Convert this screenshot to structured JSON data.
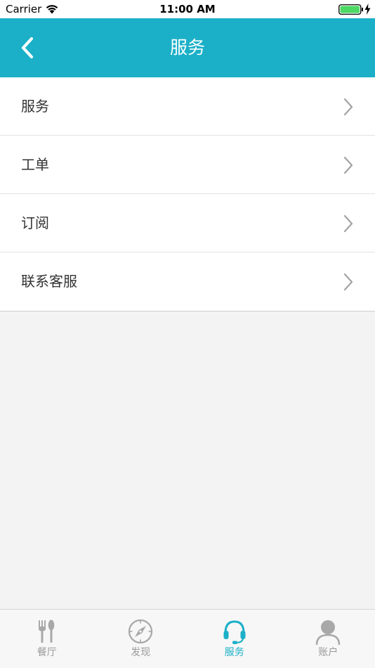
{
  "status_bar": {
    "carrier": "Carrier",
    "time": "11:00 AM"
  },
  "nav": {
    "title": "服务",
    "back_icon": "chevron-left-icon"
  },
  "menu": {
    "items": [
      {
        "label": "服务"
      },
      {
        "label": "工单"
      },
      {
        "label": "订阅"
      },
      {
        "label": "联系客服"
      }
    ]
  },
  "tabs": {
    "items": [
      {
        "label": "餐厅",
        "icon": "fork-spoon-icon",
        "active": false
      },
      {
        "label": "发现",
        "icon": "compass-icon",
        "active": false
      },
      {
        "label": "服务",
        "icon": "headset-icon",
        "active": true
      },
      {
        "label": "账户",
        "icon": "user-icon",
        "active": false
      }
    ]
  },
  "colors": {
    "accent": "#1bb0c8",
    "inactive": "#9a9a9a",
    "background": "#f3f3f3",
    "battery": "#4cd964"
  }
}
